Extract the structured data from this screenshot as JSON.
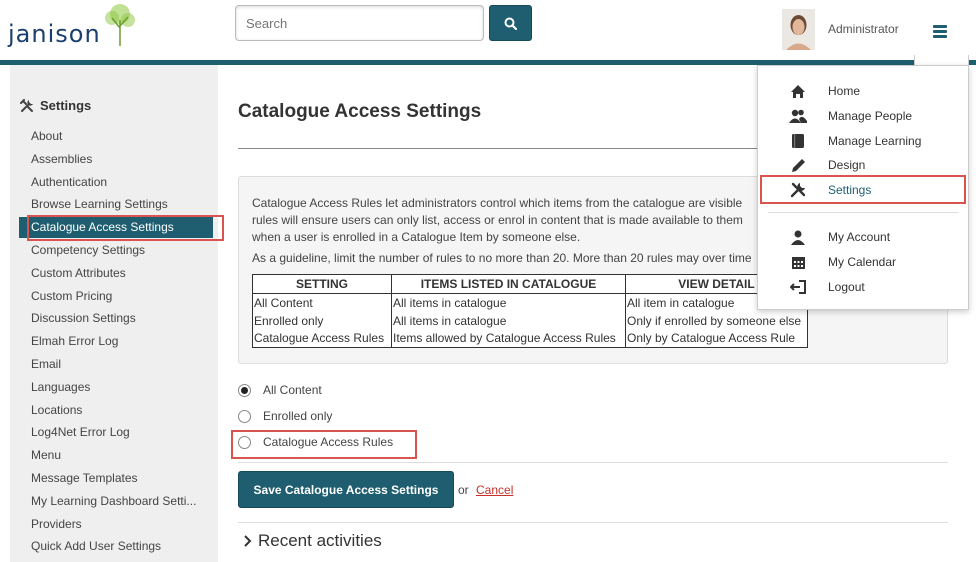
{
  "header": {
    "logo_text": "janison",
    "search_placeholder": "Search",
    "user_name": "Administrator"
  },
  "sidebar": {
    "title": "Settings",
    "items": [
      {
        "label": "About"
      },
      {
        "label": "Assemblies"
      },
      {
        "label": "Authentication"
      },
      {
        "label": "Browse Learning Settings"
      },
      {
        "label": "Catalogue Access Settings",
        "active": true
      },
      {
        "label": "Competency Settings"
      },
      {
        "label": "Custom Attributes"
      },
      {
        "label": "Custom Pricing"
      },
      {
        "label": "Discussion Settings"
      },
      {
        "label": "Elmah Error Log"
      },
      {
        "label": "Email"
      },
      {
        "label": "Languages"
      },
      {
        "label": "Locations"
      },
      {
        "label": "Log4Net Error Log"
      },
      {
        "label": "Menu"
      },
      {
        "label": "Message Templates"
      },
      {
        "label": "My Learning Dashboard Setti..."
      },
      {
        "label": "Providers"
      },
      {
        "label": "Quick Add User Settings"
      }
    ]
  },
  "main": {
    "title": "Catalogue Access Settings",
    "info_line1": "Catalogue Access Rules let administrators control which items from the catalogue are visible",
    "info_line2": "rules will ensure users can only list, access or enrol in content that is made available to them",
    "info_line3": "when a user is enrolled in a Catalogue Item by someone else.",
    "info_line4": "As a guideline, limit the number of rules to no more than 20. More than 20 rules may over time",
    "table": {
      "headers": [
        "SETTING",
        "ITEMS LISTED IN CATALOGUE",
        "VIEW DETAIL"
      ],
      "rows": [
        [
          "All Content",
          "All items in catalogue",
          "All item in catalogue"
        ],
        [
          "Enrolled only",
          "All items in catalogue",
          "Only if enrolled by someone else"
        ],
        [
          "Catalogue Access Rules",
          "Items allowed by Catalogue Access Rules",
          "Only by Catalogue Access Rule"
        ]
      ]
    },
    "options": [
      {
        "label": "All Content",
        "selected": true
      },
      {
        "label": "Enrolled only",
        "selected": false
      },
      {
        "label": "Catalogue Access Rules",
        "selected": false
      }
    ],
    "save_label": "Save Catalogue Access Settings",
    "or_text": "or",
    "cancel_label": "Cancel",
    "recent_label": "Recent activities"
  },
  "dropdown": {
    "items": [
      {
        "label": "Home",
        "icon": "home-icon"
      },
      {
        "label": "Manage People",
        "icon": "people-icon"
      },
      {
        "label": "Manage Learning",
        "icon": "book-icon"
      },
      {
        "label": "Design",
        "icon": "pencil-icon"
      },
      {
        "label": "Settings",
        "icon": "wrench-icon",
        "active": true
      },
      {
        "label": "My Account",
        "icon": "user-icon"
      },
      {
        "label": "My Calendar",
        "icon": "calendar-icon"
      },
      {
        "label": "Logout",
        "icon": "logout-icon"
      }
    ]
  },
  "colors": {
    "accent": "#1e5e70",
    "highlight_box": "#d9534f",
    "cancel_link": "#c9302c"
  }
}
